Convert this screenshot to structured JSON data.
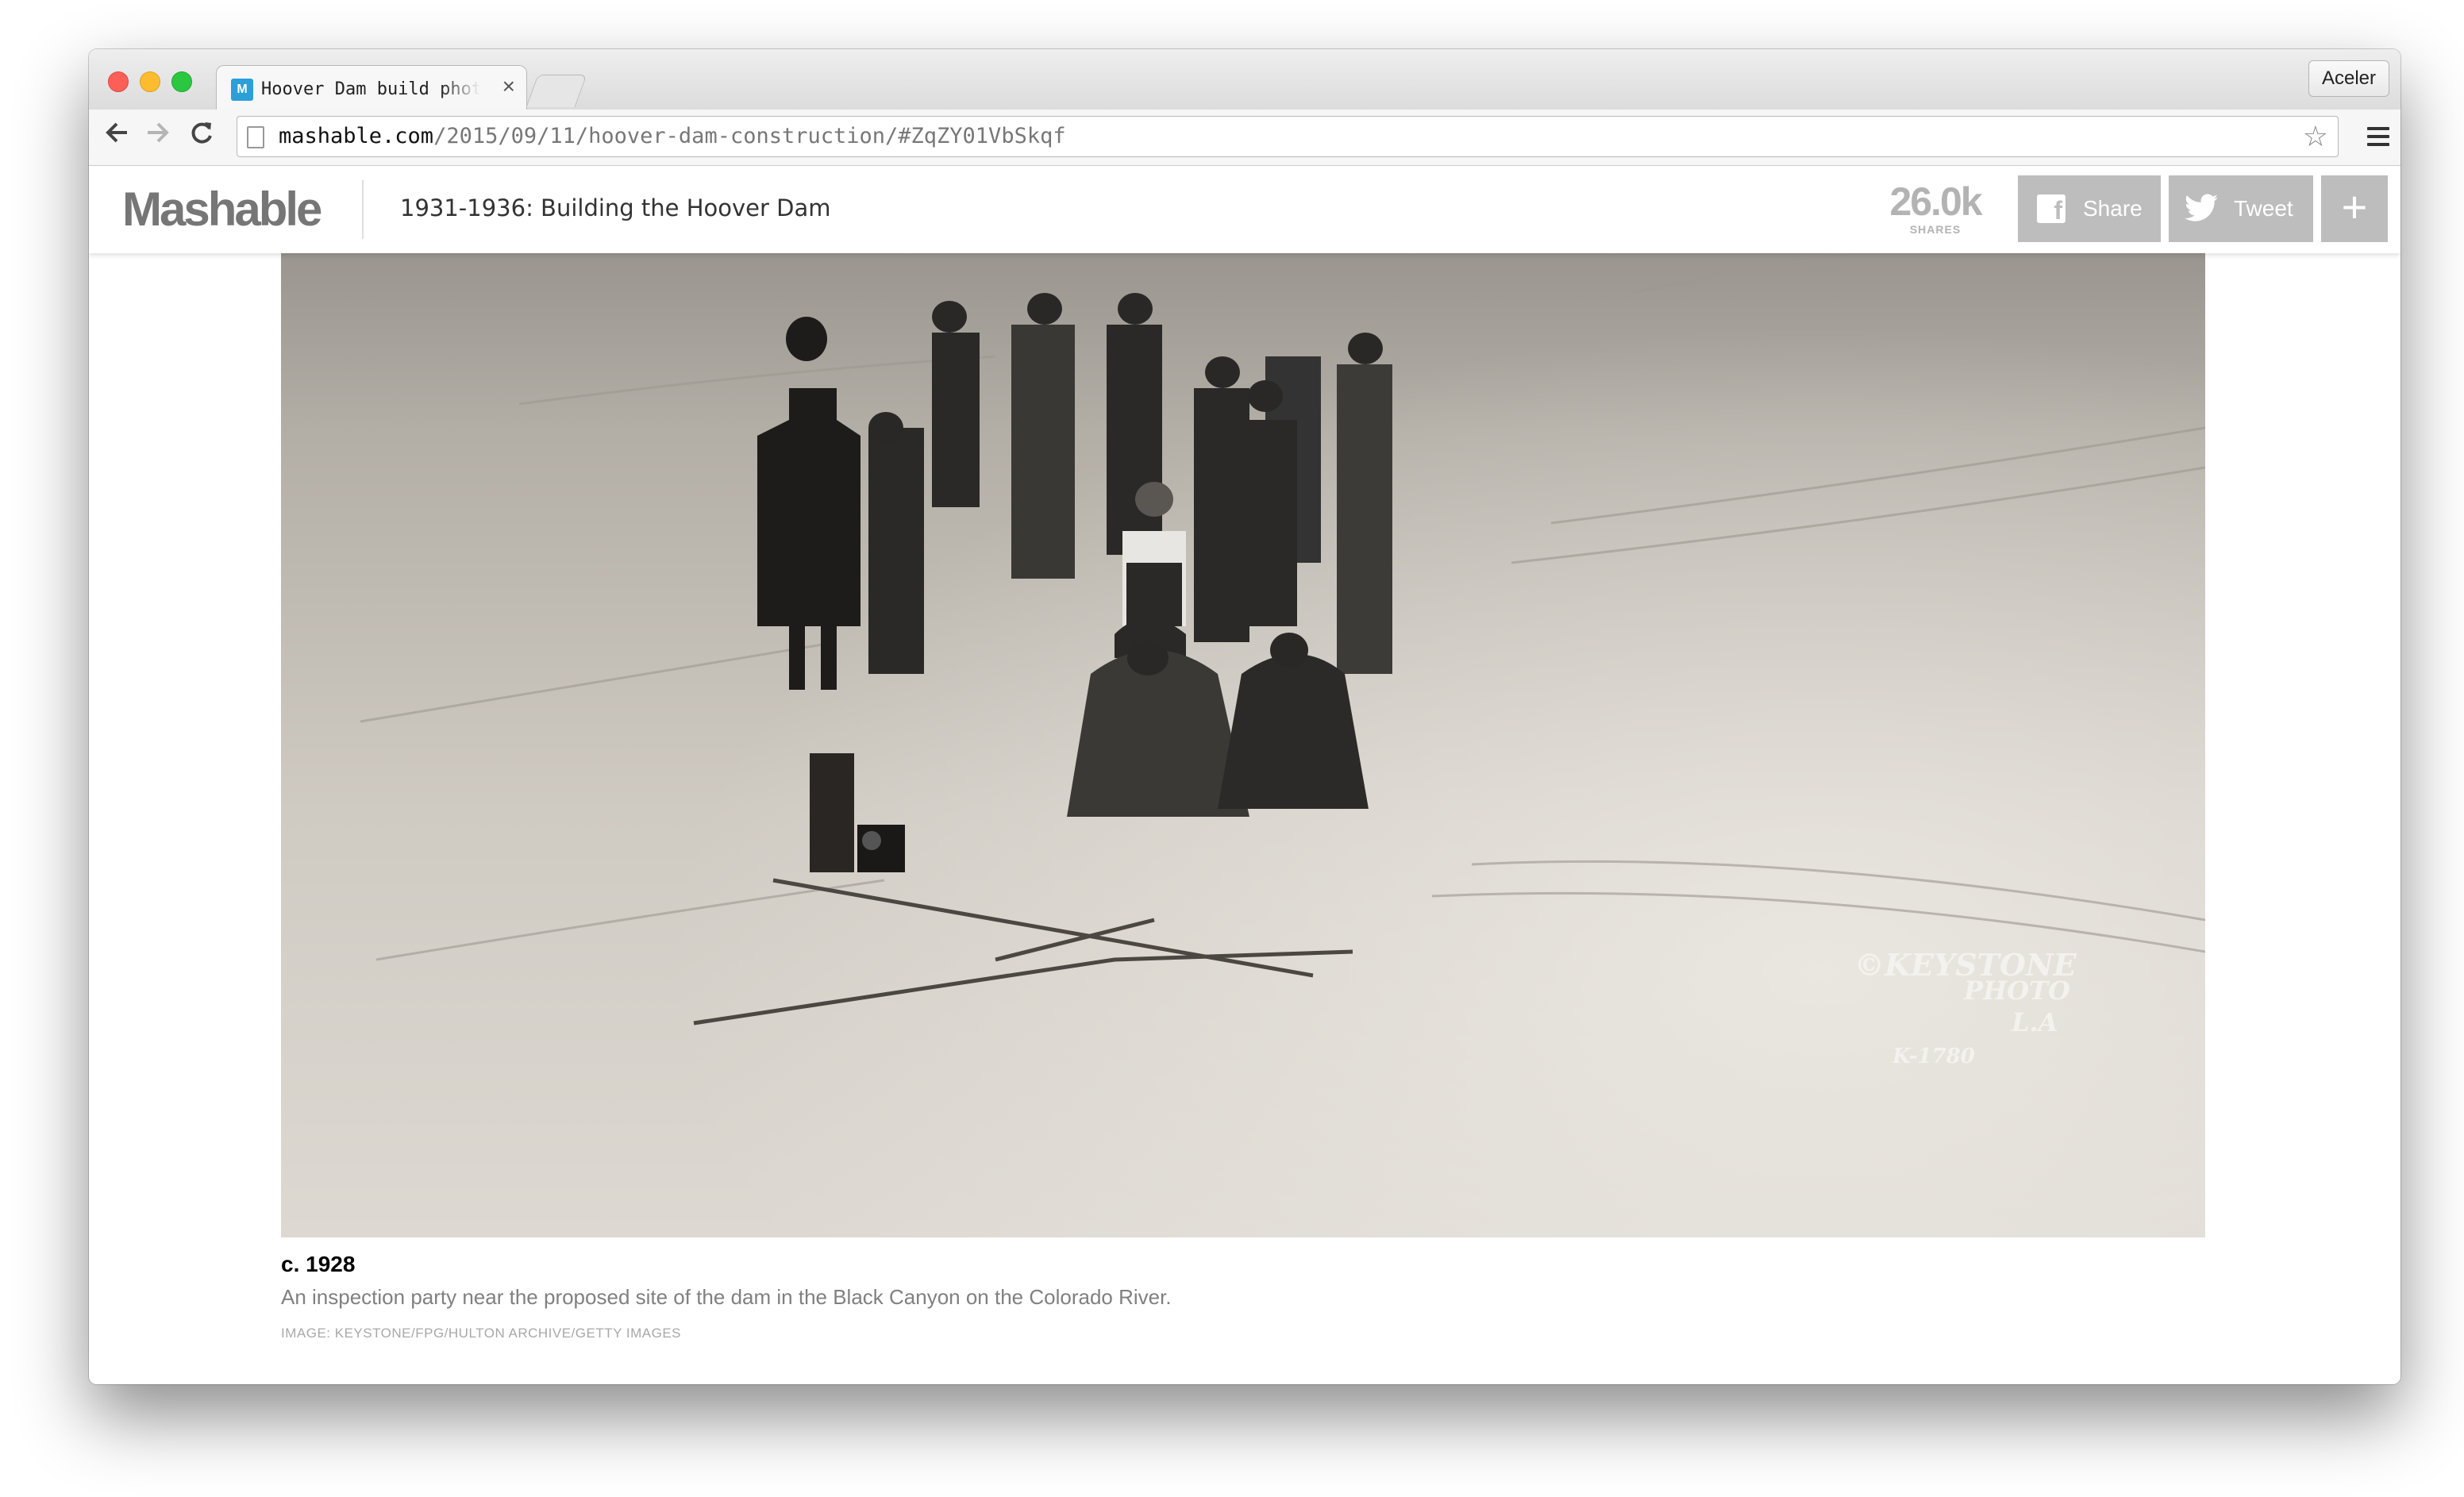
{
  "browser": {
    "tab": {
      "favicon_letter": "M",
      "title": "Hoover Dam build photos re"
    },
    "extension_button": "Aceler",
    "address": {
      "host": "mashable.com",
      "path": "/2015/09/11/hoover-dam-construction/#ZqZY01VbSkqf"
    }
  },
  "site": {
    "logo": "Mashable",
    "article_title": "1931-1936: Building the Hoover Dam",
    "shares": {
      "count": "26.0k",
      "label": "SHARES"
    },
    "share_buttons": {
      "facebook": "Share",
      "twitter": "Tweet",
      "more": "+"
    }
  },
  "photo": {
    "watermark": [
      "©KEYSTONE",
      "PHOTO",
      "L.A",
      "K-1780"
    ],
    "caption_date": "c. 1928",
    "caption_text": "An inspection party near the proposed site of the dam in the Black Canyon on the Colorado River.",
    "credit": "IMAGE: KEYSTONE/FPG/HULTON ARCHIVE/GETTY IMAGES"
  },
  "colors": {
    "share_button_bg": "#bdbdbd",
    "logo": "#767676"
  }
}
